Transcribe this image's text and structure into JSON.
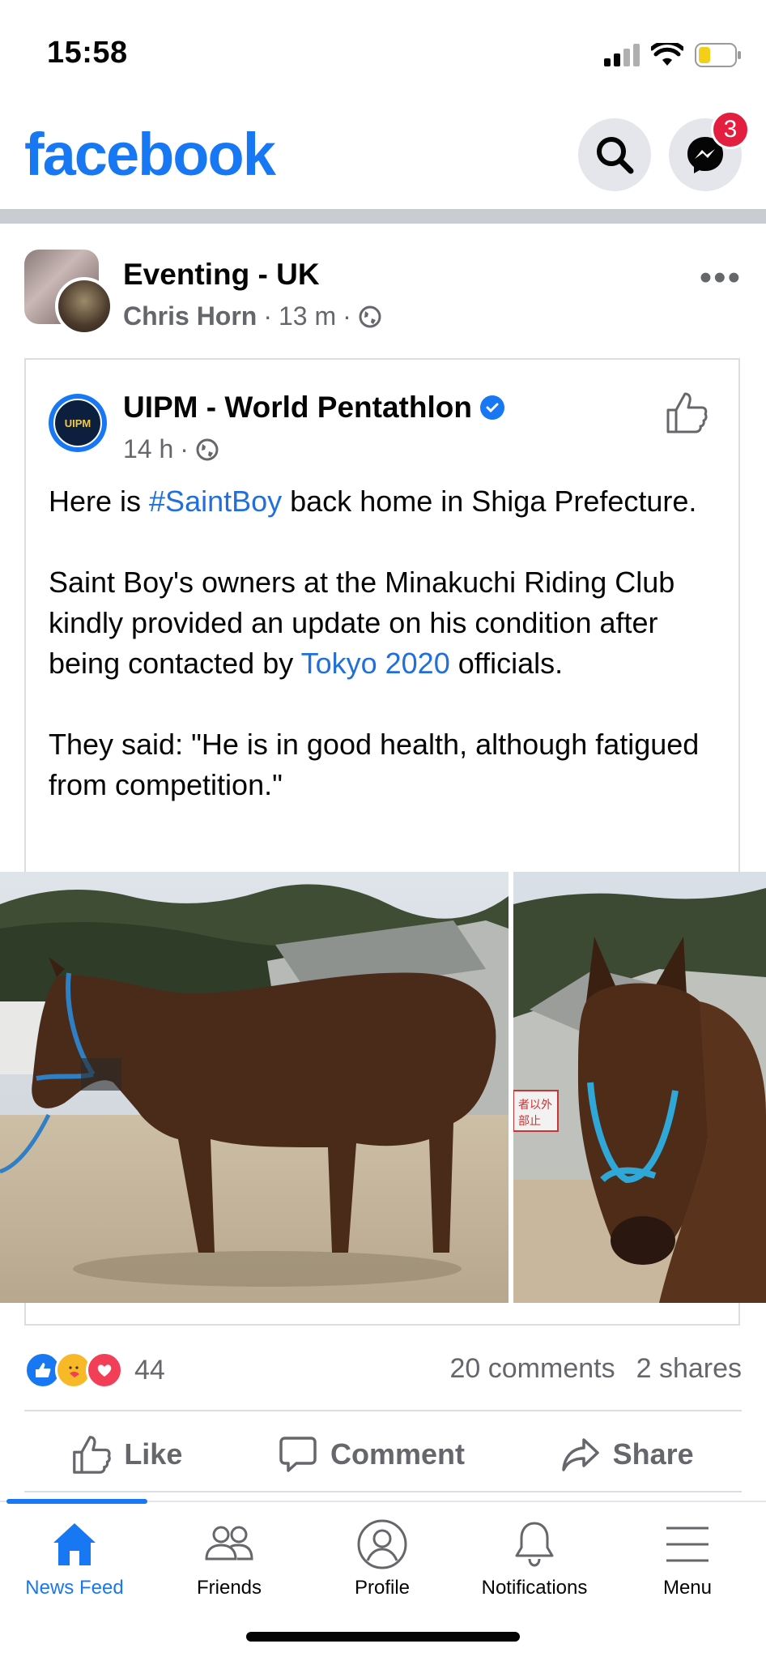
{
  "status_bar": {
    "time": "15:58"
  },
  "header": {
    "logo_text": "facebook",
    "messenger_badge": "3"
  },
  "post": {
    "group_name": "Eventing - UK",
    "author": "Chris Horn",
    "time": "13 m",
    "separator": "·",
    "shared": {
      "page_name": "UIPM - World Pentathlon",
      "logo_text": "UIPM",
      "time": "14 h",
      "text_p1_before": "Here is ",
      "hashtag": "#SaintBoy",
      "text_p1_after": " back home in Shiga Prefecture.",
      "text_p2_before": "Saint Boy's owners at the Minakuchi Riding Club kindly provided an update on his condition after being contacted by ",
      "mention": "Tokyo 2020",
      "text_p2_after": " officials.",
      "text_p3": "They said: \"He is in good health, although fatigued from competition.\""
    },
    "reaction_count": "44",
    "comments": "20 comments",
    "shares": "2 shares",
    "actions": {
      "like": "Like",
      "comment": "Comment",
      "share": "Share"
    }
  },
  "tabs": [
    {
      "label": "News Feed",
      "icon": "home-icon",
      "active": true
    },
    {
      "label": "Friends",
      "icon": "friends-icon",
      "active": false
    },
    {
      "label": "Profile",
      "icon": "profile-icon",
      "active": false
    },
    {
      "label": "Notifications",
      "icon": "bell-icon",
      "active": false
    },
    {
      "label": "Menu",
      "icon": "menu-icon",
      "active": false
    }
  ],
  "colors": {
    "brand": "#1877f2",
    "link": "#216fdb",
    "muted": "#65676b",
    "badge": "#e41e3f"
  }
}
